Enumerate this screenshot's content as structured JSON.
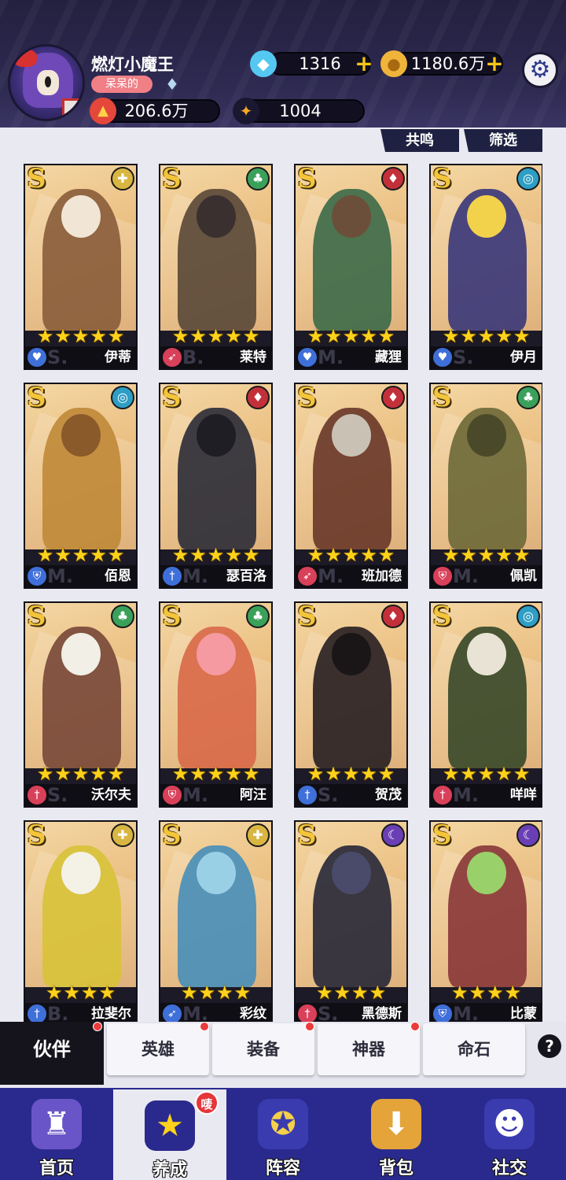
{
  "player": {
    "name": "燃灯小魔王",
    "title": "呆呆的",
    "power": "206.6万",
    "energy": "1004"
  },
  "currency": {
    "diamonds": "1316",
    "gold": "1180.6万"
  },
  "top_buttons": {
    "resonance": "共鸣",
    "filter": "筛选"
  },
  "heroes": [
    {
      "name": "伊蒂",
      "grade": "S",
      "stars": 5,
      "faction_icon": "light-icon",
      "faction_color": "#d9b642",
      "role_icon": "heart-icon",
      "role_color": "#3f6fd8",
      "tier": "S."
    },
    {
      "name": "莱特",
      "grade": "S",
      "stars": 5,
      "faction_icon": "forest-icon",
      "faction_color": "#3aa15a",
      "role_icon": "bow-icon",
      "role_color": "#d94059",
      "tier": "B."
    },
    {
      "name": "藏狸",
      "grade": "S",
      "stars": 5,
      "faction_icon": "fire-icon",
      "faction_color": "#c3303a",
      "role_icon": "heart-icon",
      "role_color": "#3f6fd8",
      "tier": "M."
    },
    {
      "name": "伊月",
      "grade": "S",
      "stars": 5,
      "faction_icon": "water-icon",
      "faction_color": "#2e9ec4",
      "role_icon": "heart-icon",
      "role_color": "#3f6fd8",
      "tier": "S."
    },
    {
      "name": "佰恩",
      "grade": "S",
      "stars": 5,
      "faction_icon": "water-icon",
      "faction_color": "#2e9ec4",
      "role_icon": "shield-icon",
      "role_color": "#3f6fd8",
      "tier": "M."
    },
    {
      "name": "瑟百洛",
      "grade": "S",
      "stars": 5,
      "faction_icon": "fire-icon",
      "faction_color": "#c3303a",
      "role_icon": "sword-icon",
      "role_color": "#3f6fd8",
      "tier": "M."
    },
    {
      "name": "班加德",
      "grade": "S",
      "stars": 5,
      "faction_icon": "fire-icon",
      "faction_color": "#c3303a",
      "role_icon": "bow-icon",
      "role_color": "#d94059",
      "tier": "M."
    },
    {
      "name": "佩凯",
      "grade": "S",
      "stars": 5,
      "faction_icon": "forest-icon",
      "faction_color": "#3aa15a",
      "role_icon": "shield-icon",
      "role_color": "#d94059",
      "tier": "M."
    },
    {
      "name": "沃尔夫",
      "grade": "S",
      "stars": 5,
      "faction_icon": "forest-icon",
      "faction_color": "#3aa15a",
      "role_icon": "sword-icon",
      "role_color": "#d94059",
      "tier": "S."
    },
    {
      "name": "阿汪",
      "grade": "S",
      "stars": 5,
      "faction_icon": "forest-icon",
      "faction_color": "#3aa15a",
      "role_icon": "shield-icon",
      "role_color": "#d94059",
      "tier": "M."
    },
    {
      "name": "贺茂",
      "grade": "S",
      "stars": 5,
      "faction_icon": "fire-icon",
      "faction_color": "#c3303a",
      "role_icon": "sword-icon",
      "role_color": "#3f6fd8",
      "tier": "S."
    },
    {
      "name": "咩咩",
      "grade": "S",
      "stars": 5,
      "faction_icon": "water-icon",
      "faction_color": "#2e9ec4",
      "role_icon": "sword-icon",
      "role_color": "#d94059",
      "tier": "M."
    },
    {
      "name": "拉斐尔",
      "grade": "S",
      "stars": 4,
      "faction_icon": "light-icon",
      "faction_color": "#d9b642",
      "role_icon": "sword-icon",
      "role_color": "#3f6fd8",
      "tier": "B."
    },
    {
      "name": "彩纹",
      "grade": "S",
      "stars": 4,
      "faction_icon": "light-icon",
      "faction_color": "#d9b642",
      "role_icon": "bow-icon",
      "role_color": "#3f6fd8",
      "tier": "M."
    },
    {
      "name": "黑德斯",
      "grade": "S",
      "stars": 4,
      "faction_icon": "dark-icon",
      "faction_color": "#6a3fb5",
      "role_icon": "sword-icon",
      "role_color": "#d94059",
      "tier": "S."
    },
    {
      "name": "比蒙",
      "grade": "S",
      "stars": 4,
      "faction_icon": "dark-icon",
      "faction_color": "#6a3fb5",
      "role_icon": "shield-icon",
      "role_color": "#3f6fd8",
      "tier": "M."
    }
  ],
  "subtabs": {
    "active": "伙伴",
    "items": [
      "英雄",
      "装备",
      "神器",
      "命石"
    ]
  },
  "help_label": "?",
  "bottom_nav": [
    {
      "label": "首页",
      "icon": "castle-icon"
    },
    {
      "label": "养成",
      "icon": "star-upgrade-icon",
      "badge": "唛"
    },
    {
      "label": "阵容",
      "icon": "formation-icon"
    },
    {
      "label": "背包",
      "icon": "bag-icon"
    },
    {
      "label": "社交",
      "icon": "social-icon"
    }
  ]
}
